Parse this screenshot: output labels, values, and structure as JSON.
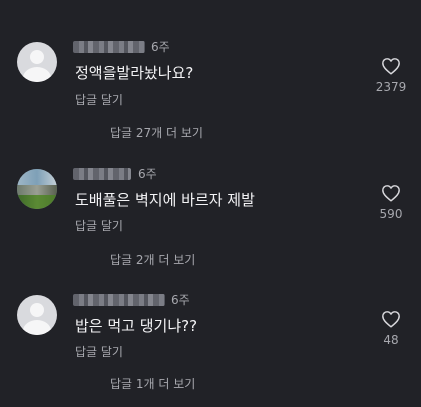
{
  "comments": [
    {
      "time": "6주",
      "text": "정액을발라놨나요?",
      "reply_label": "답글 달기",
      "more_replies": "답글 27개 더 보기",
      "like_count": "2379"
    },
    {
      "time": "6주",
      "text": "도배풀은 벽지에 바르자 제발",
      "reply_label": "답글 달기",
      "more_replies": "답글 2개 더 보기",
      "like_count": "590"
    },
    {
      "time": "6주",
      "text": "밥은 먹고 댕기냐??",
      "reply_label": "답글 달기",
      "more_replies": "답글 1개 더 보기",
      "like_count": "48"
    }
  ],
  "icons": {
    "like": "heart-outline-icon",
    "avatar_default": "default-user-avatar"
  },
  "colors": {
    "background": "#212227",
    "text": "#f3f3f5",
    "muted": "#a7a8ae"
  }
}
